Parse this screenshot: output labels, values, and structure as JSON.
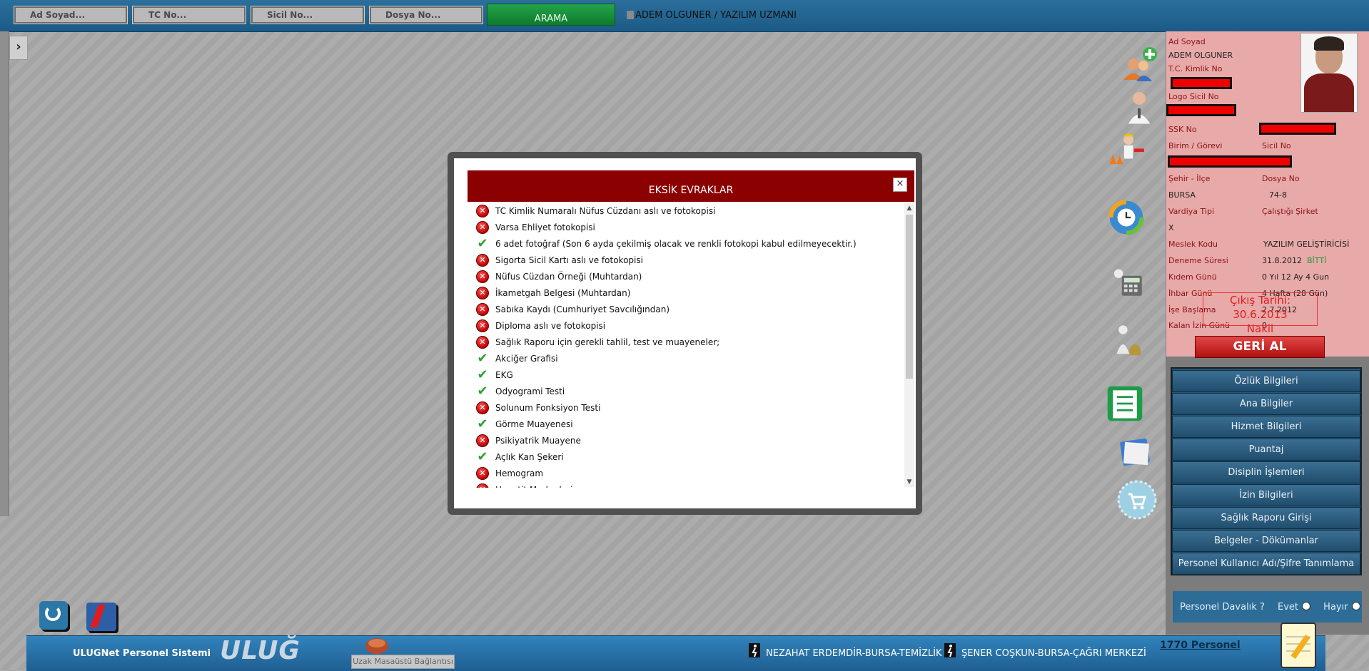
{
  "top": {
    "search_fields": [
      "Ad Soyad...",
      "TC No...",
      "Sicil No...",
      "Dosya No..."
    ],
    "search_button": "ARAMA",
    "user": "ADEM OLGUNER / YAZILIM UZMANI"
  },
  "modal": {
    "title": "EKSİK EVRAKLAR",
    "close_label": "×",
    "items": [
      {
        "text": "TC Kimlik Numaralı Nüfus Cüzdanı aslı ve fotokopisi",
        "status": "missing"
      },
      {
        "text": "Varsa Ehliyet fotokopisi",
        "status": "missing"
      },
      {
        "text": "6 adet fotoğraf (Son 6 ayda çekilmiş olacak ve renkli fotokopi kabul edilmeyecektir.)",
        "status": "ok"
      },
      {
        "text": "Sigorta Sicil Kartı aslı ve fotokopisi",
        "status": "missing"
      },
      {
        "text": "Nüfus Cüzdan Örneği (Muhtardan)",
        "status": "missing"
      },
      {
        "text": "İkametgah Belgesi (Muhtardan)",
        "status": "missing"
      },
      {
        "text": "Sabıka Kaydı (Cumhuriyet Savcılığından)",
        "status": "missing"
      },
      {
        "text": "Diploma aslı ve fotokopisi",
        "status": "missing"
      },
      {
        "text": "Sağlık Raporu için gerekli tahlil, test ve muayeneler;",
        "status": "missing"
      },
      {
        "text": "Akciğer Grafisi",
        "status": "ok"
      },
      {
        "text": "EKG",
        "status": "ok"
      },
      {
        "text": "Odyogrami Testi",
        "status": "ok"
      },
      {
        "text": "Solunum Fonksiyon Testi",
        "status": "missing"
      },
      {
        "text": "Görme Muayenesi",
        "status": "ok"
      },
      {
        "text": "Psikiyatrik Muayene",
        "status": "missing"
      },
      {
        "text": "Açlık Kan Şekeri",
        "status": "ok"
      },
      {
        "text": "Hemogram",
        "status": "missing"
      },
      {
        "text": "Hepatit Markerleri",
        "status": "missing"
      }
    ]
  },
  "profile": {
    "ad_soyad_label": "Ad Soyad",
    "ad_soyad": "ADEM OLGUNER",
    "tc_label": "T.C. Kimlik No",
    "logo_sicil_label": "Logo Sicil No",
    "ssk_label": "SSK No",
    "birim_label": "Birim / Görevi",
    "sicil_label": "Sicil No",
    "sehir_label": "Şehir - İlçe",
    "dosya_label": "Dosya No",
    "sehir": "BURSA",
    "dosya": "74-8",
    "vardiya_label": "Vardiya Tipi",
    "calistigi_label": "Çalıştığı Şirket",
    "vardiya": "X",
    "meslek_label": "Meslek Kodu",
    "meslek": "YAZILIM GELİŞTİRİCİSİ",
    "deneme_label": "Deneme Süresi",
    "deneme": "31.8.2012",
    "deneme_status": "BİTTİ",
    "kidem_label": "Kıdem Günü",
    "kidem": "0 Yıl 12 Ay 4 Gun",
    "ihbar_label": "İhbar Günü",
    "ihbar": "4 Hafta (28 Gün)",
    "ise_label": "İşe Başlama",
    "ise": "2.7.2012",
    "kalan_label": "Kalan İzin Günü",
    "kalan": "0",
    "cikis": "Çıkış Tarihi: 30.6.2013",
    "nakil": "Nakil",
    "geri_al": "GERİ AL"
  },
  "menu": [
    "Özlük Bilgileri",
    "Ana Bilgiler",
    "Hizmet Bilgileri",
    "Puantaj",
    "Disiplin İşlemleri",
    "İzin Bilgileri",
    "Sağlık Raporu Girişi",
    "Belgeler - Dökümanlar",
    "Personel Kullanıcı Adı/Şifre Tanımlama"
  ],
  "davet": {
    "question": "Personel Davalık ?",
    "yes": "Evet",
    "no": "Hayır"
  },
  "bottom": {
    "system": "ULUGNet Personel Sistemi",
    "brand": "ULUĞ",
    "remote": "Uzak Masaüstü Bağlantısı",
    "ticker1": "NEZAHAT ERDEMDİR-BURSA-TEMİZLİK",
    "ticker2": "ŞENER COŞKUN-BURSA-ÇAĞRI MERKEZİ",
    "count": "1770 Personel"
  },
  "colors": {
    "modal_header": "#8b0000",
    "panel": "#e8a9a9",
    "accent_red": "#e00000",
    "menu_blue": "#2d5d80"
  }
}
